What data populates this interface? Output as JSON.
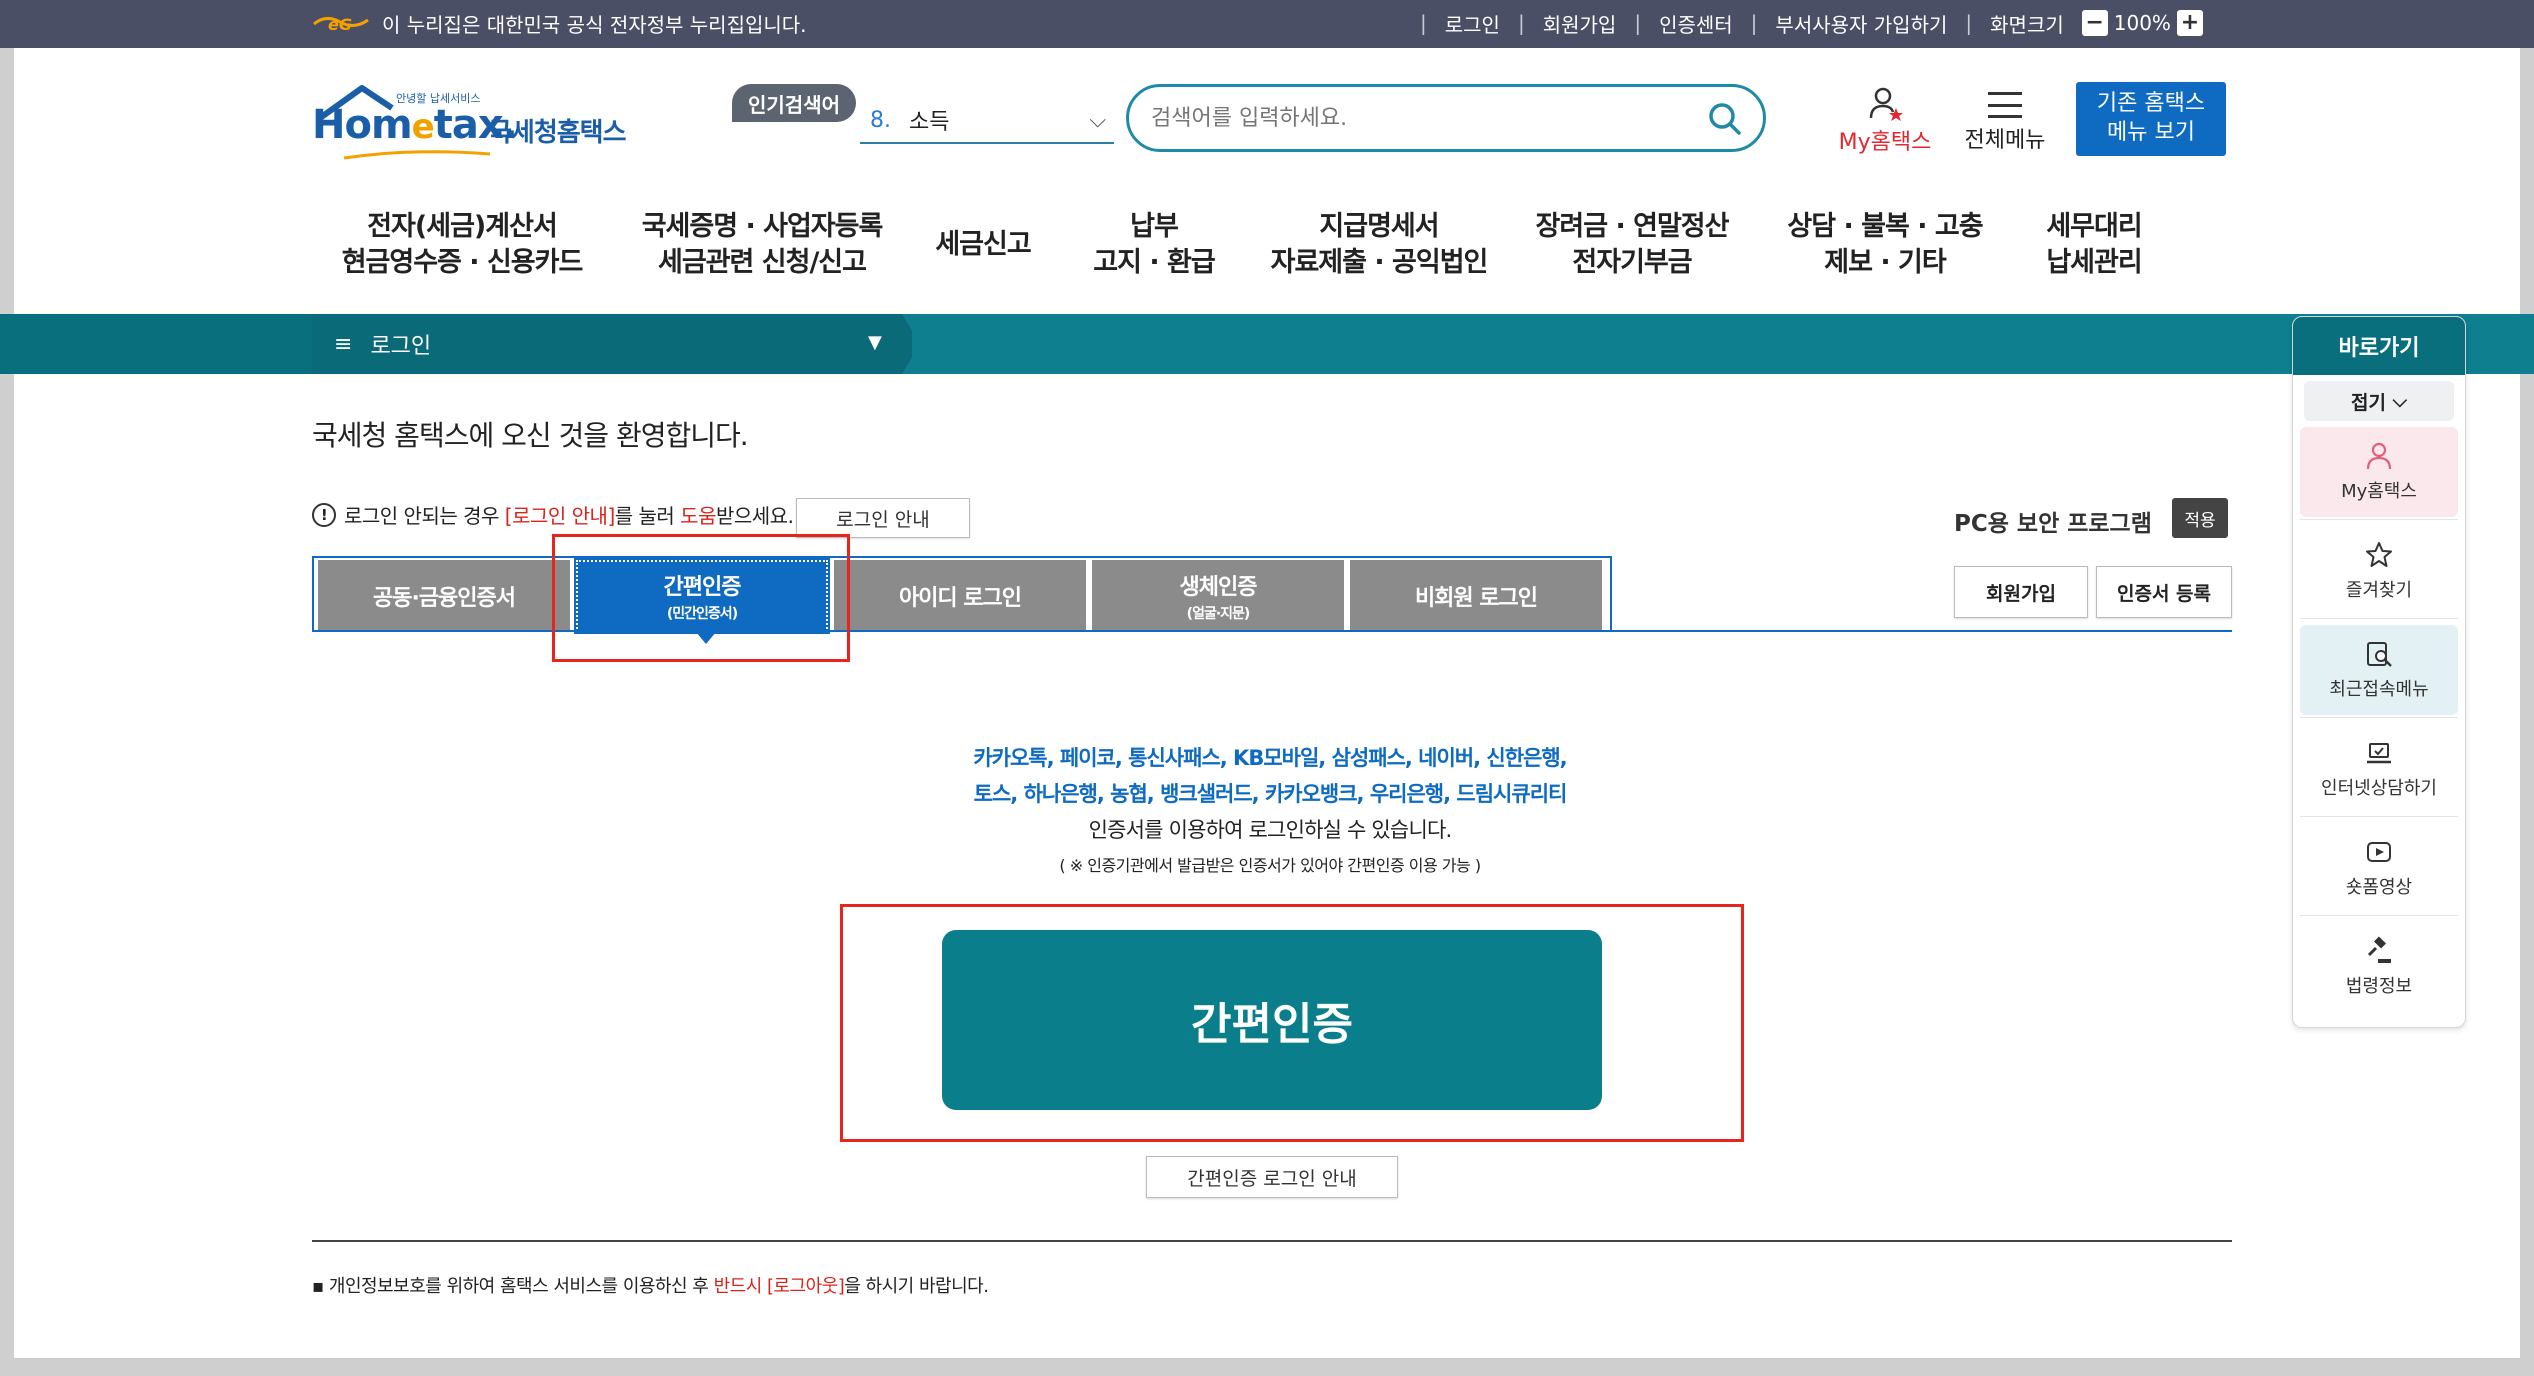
{
  "topbar": {
    "gov_notice": "이 누리집은 대한민국 공식 전자정부 누리집입니다.",
    "links": [
      "로그인",
      "회원가입",
      "인증센터",
      "부서사용자 가입하기",
      "화면크기"
    ],
    "zoom_minus": "−",
    "zoom_plus": "+",
    "zoom_level": "100%"
  },
  "header": {
    "logo_small": "안녕할 납세서비스",
    "logo_brand_a": "Hom",
    "logo_brand_e": "e",
    "logo_brand_b": "tax.",
    "logo_kor": "국세청홈택스",
    "popular_label": "인기검색어",
    "popular_rank": "8.",
    "popular_term": "소득",
    "search_placeholder": "검색어를 입력하세요.",
    "myhome_label": "My홈택스",
    "allmenu_label": "전체메뉴",
    "oldmenu_line1": "기존 홈택스",
    "oldmenu_line2": "메뉴 보기"
  },
  "gnb": [
    {
      "line1": "전자(세금)계산서",
      "line2": "현금영수증 · 신용카드"
    },
    {
      "line1": "국세증명 · 사업자등록",
      "line2": "세금관련 신청/신고"
    },
    {
      "line1": "세금신고",
      "line2": ""
    },
    {
      "line1": "납부",
      "line2": "고지 · 환급"
    },
    {
      "line1": "지급명세서",
      "line2": "자료제출 · 공익법인"
    },
    {
      "line1": "장려금 · 연말정산",
      "line2": "전자기부금"
    },
    {
      "line1": "상담 · 불복 · 고충",
      "line2": "제보 · 기타"
    },
    {
      "line1": "세무대리",
      "line2": "납세관리"
    }
  ],
  "breadcrumb": {
    "label": "로그인"
  },
  "quick": {
    "title": "바로가기",
    "fold": "접기",
    "items": [
      "My홈택스",
      "즐겨찾기",
      "최근접속메뉴",
      "인터넷상담하기",
      "숏폼영상",
      "법령정보"
    ]
  },
  "content": {
    "welcome": "국세청 홈택스에 오신 것을 환영합니다.",
    "help_a": "로그인 안되는 경우 ",
    "help_link": "[로그인 안내]",
    "help_b": "를 눌러 ",
    "help_red": "도움",
    "help_c": "받으세요.",
    "guide_button": "로그인 안내",
    "pc_security": "PC용 보안 프로그램",
    "apply_button": "적용",
    "join_button": "회원가입",
    "cert_button": "인증서 등록",
    "tabs": [
      {
        "label": "공동·금융인증서",
        "sub": ""
      },
      {
        "label": "간편인증",
        "sub": "(민간인증서)"
      },
      {
        "label": "아이디 로그인",
        "sub": ""
      },
      {
        "label": "생체인증",
        "sub": "(얼굴·지문)"
      },
      {
        "label": "비회원 로그인",
        "sub": ""
      }
    ],
    "providers_line1": "카카오톡, 페이코, 통신사패스, KB모바일, 삼성패스, 네이버, 신한은행,",
    "providers_line2": "토스, 하나은행, 농협, 뱅크샐러드, 카카오뱅크, 우리은행, 드림시큐리티",
    "providers_text": "인증서를 이용하여 로그인하실 수 있습니다.",
    "providers_note": "( ※ 인증기관에서 발급받은 인증서가 있어야 간편인증 이용 가능 )",
    "main_button": "간편인증",
    "simple_guide": "간편인증 로그인 안내",
    "foot_a": "개인정보보호를 위하여 홈택스 서비스를 이용하신 후 ",
    "foot_red": "반드시 [로그아웃]",
    "foot_b": "을 하시기 바랍니다."
  },
  "colors": {
    "brand_blue": "#0e6bc1",
    "teal": "#0b7e8c",
    "highlight_red": "#e8251c",
    "topbar": "#4b4f66"
  }
}
